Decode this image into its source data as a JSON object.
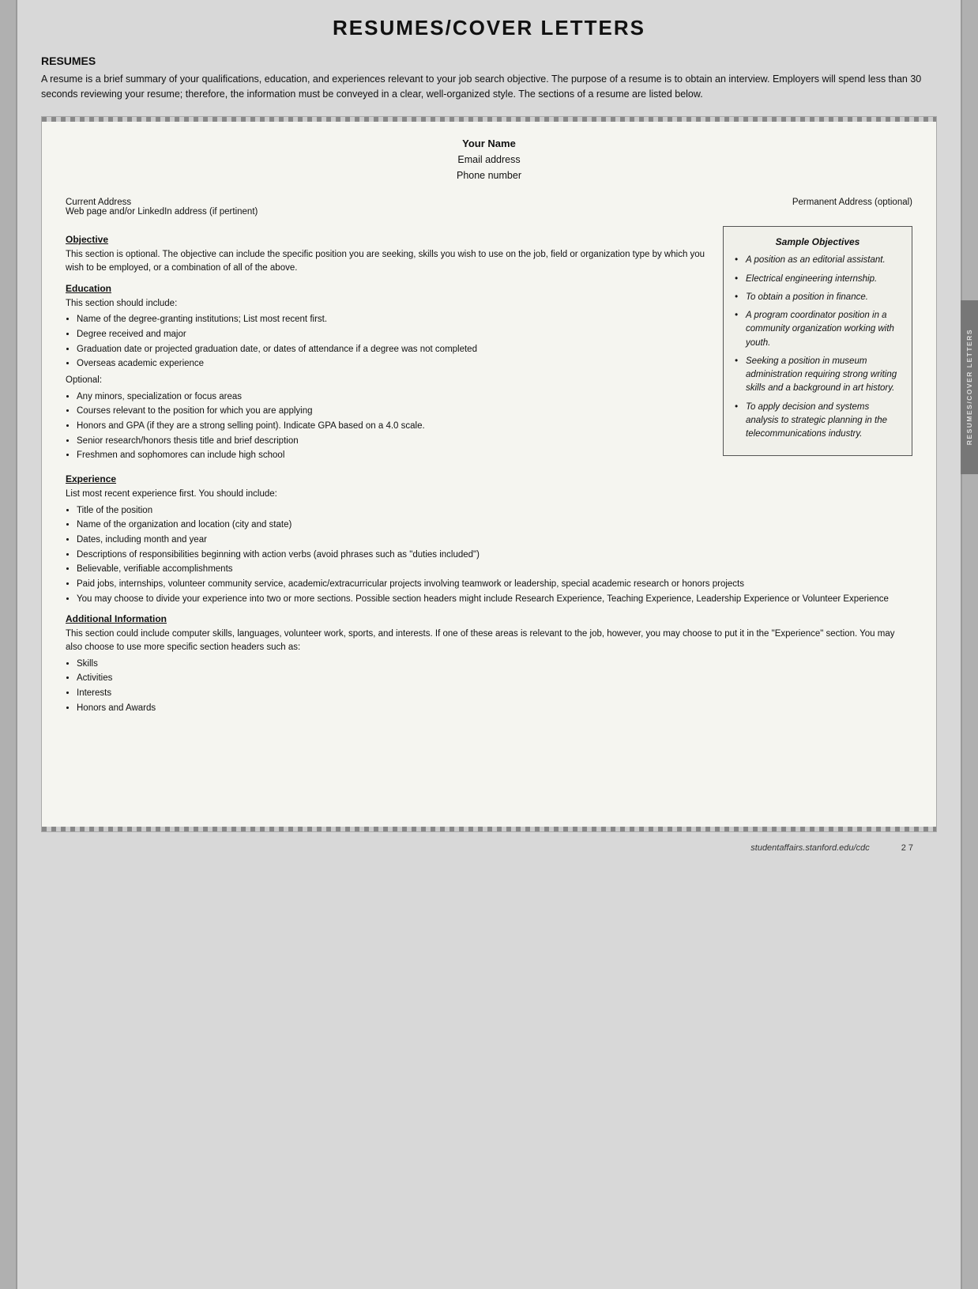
{
  "page": {
    "title": "RESUMES/COVER LETTERS",
    "section_heading": "RESUMES",
    "intro": "A resume is a brief summary of your qualifications, education, and experiences relevant to your job search objective. The purpose of a resume is to obtain an interview. Employers will spend less than 30 seconds reviewing your resume; therefore, the information must be conveyed in a clear, well-organized style. The sections of a resume are listed below."
  },
  "resume_template": {
    "name": "Your Name",
    "email": "Email address",
    "phone": "Phone number",
    "current_address_label": "Current Address",
    "web_label": "Web page and/or LinkedIn address (if pertinent)",
    "permanent_address_label": "Permanent Address (optional)",
    "objective_title": "Objective",
    "objective_text": "This section is optional. The objective can include the specific position you are seeking, skills you wish to use on the job, field or organization type by which you wish to be employed, or a combination of all of the above.",
    "education_title": "Education",
    "education_intro": "This section should include:",
    "education_bullets": [
      "Name of the degree-granting institutions; List most recent first.",
      "Degree received and major",
      "Graduation date or projected graduation date, or dates of attendance if a degree was not completed",
      "Overseas academic experience"
    ],
    "education_optional_label": "Optional:",
    "education_optional_bullets": [
      "Any minors, specialization or focus areas",
      "Courses relevant to the position for which you are applying",
      "Honors and GPA (if they are a strong selling point). Indicate GPA based on a 4.0 scale.",
      "Senior research/honors thesis title and brief description",
      "Freshmen and sophomores can include high school"
    ],
    "experience_title": "Experience",
    "experience_intro": "List most recent experience first. You should include:",
    "experience_bullets": [
      "Title of the position",
      "Name of the organization and location (city and state)",
      "Dates, including month and year",
      "Descriptions of responsibilities beginning with action verbs (avoid phrases such as \"duties included\")",
      "Believable, verifiable accomplishments",
      "Paid jobs, internships, volunteer community service, academic/extracurricular projects involving teamwork or leadership, special academic research or honors projects",
      "You may choose to divide your experience into two or more sections. Possible section headers might include Research Experience, Teaching Experience, Leadership Experience or Volunteer Experience"
    ],
    "additional_title": "Additional Information",
    "additional_text": "This section could include computer skills, languages, volunteer work, sports, and interests. If one of these areas is relevant to the job, however, you may choose to put it in the \"Experience\" section. You may also choose to use more specific section headers such as:",
    "additional_bullets": [
      "Skills",
      "Activities",
      "Interests",
      "Honors and Awards"
    ]
  },
  "sample_objectives": {
    "title": "Sample Objectives",
    "items": [
      "A position as an editorial assistant.",
      "Electrical engineering internship.",
      "To obtain a position in finance.",
      "A program coordinator position in a community organization working with youth.",
      "Seeking a position in museum administration requiring strong writing skills and a background in art history.",
      "To apply decision and systems analysis to strategic planning in the telecommunications industry."
    ]
  },
  "footer": {
    "url": "studentaffairs.stanford.edu/cdc",
    "page": "2 7"
  },
  "side_tab": {
    "label": "RESUMES/COVER LETTERS"
  }
}
